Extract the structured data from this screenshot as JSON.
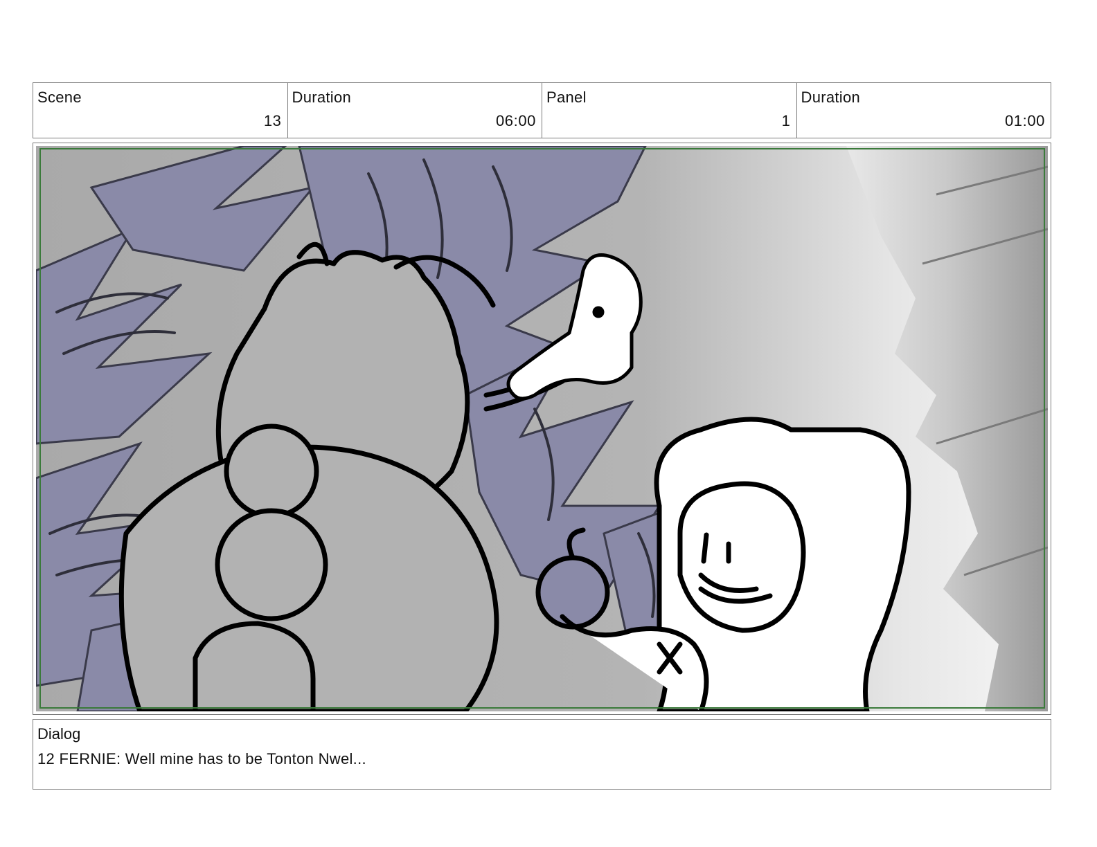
{
  "header": {
    "cells": [
      {
        "label": "Scene",
        "value": "13"
      },
      {
        "label": "Duration",
        "value": "06:00"
      },
      {
        "label": "Panel",
        "value": "1"
      },
      {
        "label": "Duration",
        "value": "01:00"
      }
    ]
  },
  "panel": {
    "safe_frame_color": "#3a7a3a",
    "foliage_color": "#8a8aa8",
    "background_color": "#aaaaaa"
  },
  "dialog": {
    "label": "Dialog",
    "text": "12 FERNIE: Well mine has to be Tonton Nwel..."
  }
}
